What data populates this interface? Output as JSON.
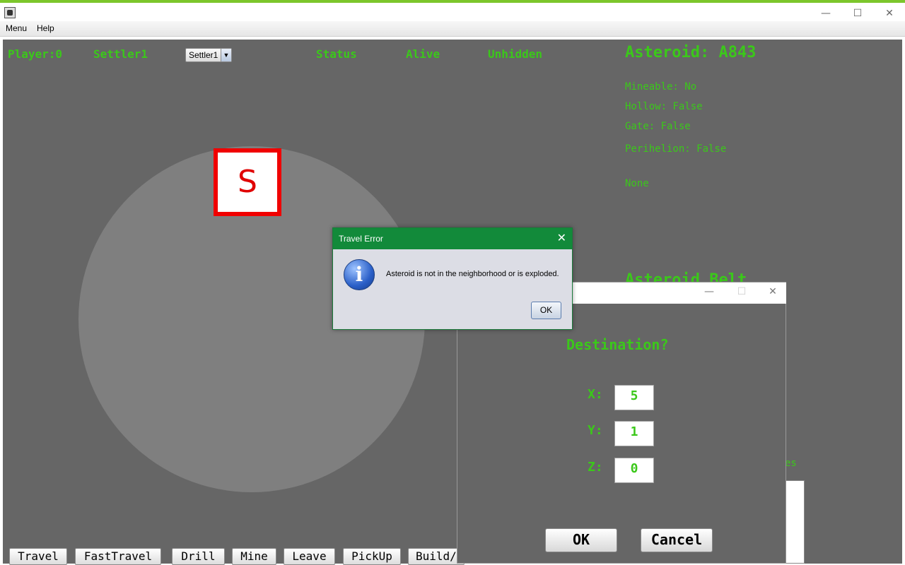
{
  "window": {
    "controls": {
      "minimize": "—",
      "maximize": "☐",
      "close": "✕"
    }
  },
  "menubar": {
    "items": [
      "Menu",
      "Help"
    ]
  },
  "header": {
    "player": "Player:0",
    "settler": "Settler1",
    "settler_select": "Settler1",
    "status_label": "Status",
    "status_value": "Alive",
    "visibility": "Unhidden"
  },
  "asteroid": {
    "title": "Asteroid: A843",
    "mineable": "Mineable: No",
    "hollow": "Hollow: False",
    "gate": "Gate: False",
    "perihelion": "Perihelion: False",
    "resource": "None",
    "belt_label": "Asteroid Belt",
    "partial_label": "es"
  },
  "settler_marker": "S",
  "actions": [
    "Travel",
    "FastTravel",
    "Drill",
    "Mine",
    "Leave",
    "PickUp",
    "Build/"
  ],
  "destination_dialog": {
    "controls": {
      "minimize": "—",
      "maximize": "☐",
      "close": "✕"
    },
    "heading": "Destination?",
    "x_label": "X:",
    "x_value": "5",
    "y_label": "Y:",
    "y_value": "1",
    "z_label": "Z:",
    "z_value": "0",
    "ok": "OK",
    "cancel": "Cancel"
  },
  "error_dialog": {
    "title": "Travel Error",
    "close": "✕",
    "icon": "i",
    "message": "Asteroid is not in the neighborhood or is exploded.",
    "ok": "OK"
  },
  "colors": {
    "accent_green": "#3bc81a",
    "settler_border": "#f00000",
    "dialog_titlebar": "#128a3a"
  }
}
